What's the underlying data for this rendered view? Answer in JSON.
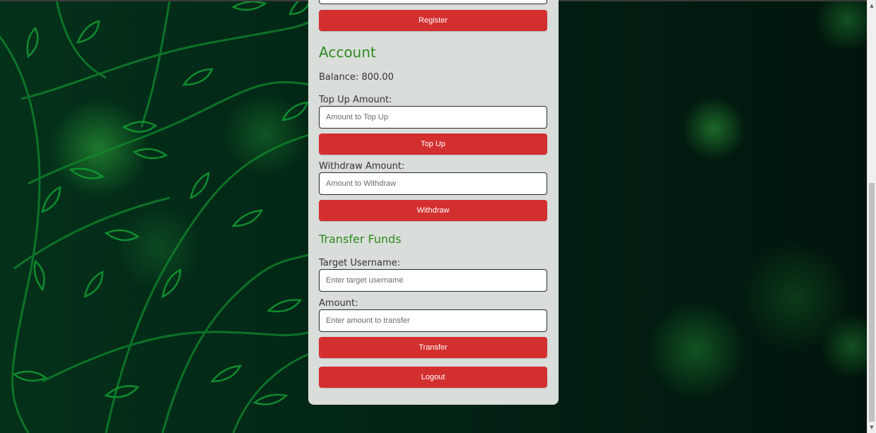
{
  "register": {
    "button_label": "Register"
  },
  "account": {
    "title": "Account",
    "balance_text": "Balance: 800.00",
    "topup": {
      "label": "Top Up Amount:",
      "placeholder": "Amount to Top Up",
      "button_label": "Top Up"
    },
    "withdraw": {
      "label": "Withdraw Amount:",
      "placeholder": "Amount to Withdraw",
      "button_label": "Withdraw"
    }
  },
  "transfer": {
    "title": "Transfer Funds",
    "target_label": "Target Username:",
    "target_placeholder": "Enter target username",
    "amount_label": "Amount:",
    "amount_placeholder": "Enter amount to transfer",
    "button_label": "Transfer"
  },
  "logout": {
    "button_label": "Logout"
  },
  "colors": {
    "accent_red": "#d32f2f",
    "heading_green": "#2e8b1e",
    "panel_bg": "#e2e6e4",
    "background_green": "#022613"
  },
  "icons": {
    "scroll_up": "scroll-up-arrow-icon",
    "scroll_down": "scroll-down-arrow-icon"
  }
}
